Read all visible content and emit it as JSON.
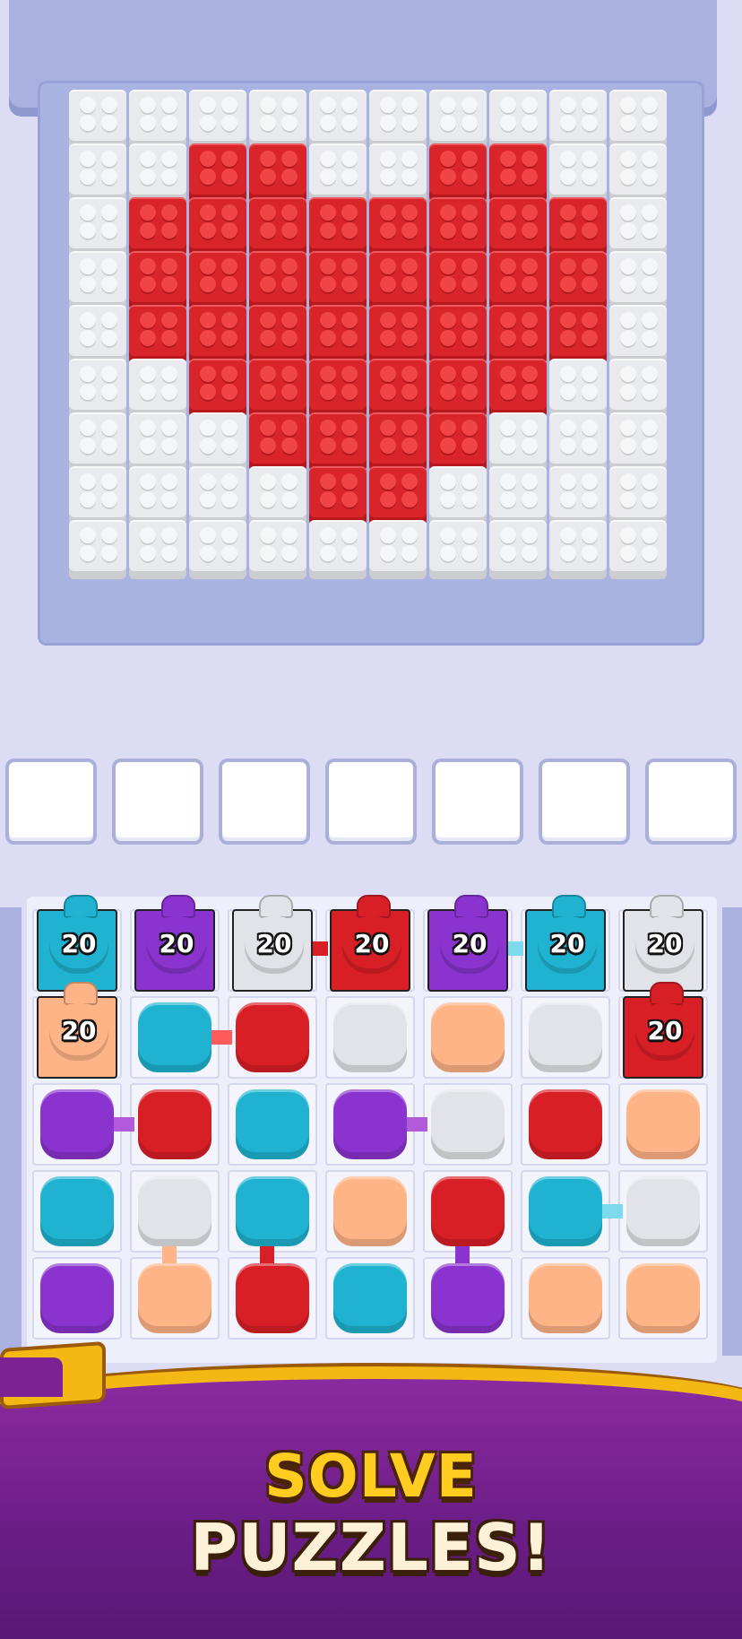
{
  "palette": {
    "cyan": "#1fb3d1",
    "purple": "#8a33cf",
    "white": "#e2e3e8",
    "red": "#d91f26",
    "peach": "#ffb488",
    "brick_white": "#e9eaee",
    "brick_red": "#d9252a"
  },
  "brick_board": {
    "rows": [
      [
        "w",
        "w",
        "w",
        "w",
        "w",
        "w",
        "w",
        "w",
        "w",
        "w"
      ],
      [
        "w",
        "w",
        "r",
        "r",
        "w",
        "w",
        "r",
        "r",
        "w",
        "w"
      ],
      [
        "w",
        "r",
        "r",
        "r",
        "r",
        "r",
        "r",
        "r",
        "r",
        "w"
      ],
      [
        "w",
        "r",
        "r",
        "r",
        "r",
        "r",
        "r",
        "r",
        "r",
        "w"
      ],
      [
        "w",
        "r",
        "r",
        "r",
        "r",
        "r",
        "r",
        "r",
        "r",
        "w"
      ],
      [
        "w",
        "w",
        "r",
        "r",
        "r",
        "r",
        "r",
        "r",
        "w",
        "w"
      ],
      [
        "w",
        "w",
        "w",
        "r",
        "r",
        "r",
        "r",
        "w",
        "w",
        "w"
      ],
      [
        "w",
        "w",
        "w",
        "w",
        "r",
        "r",
        "w",
        "w",
        "w",
        "w"
      ],
      [
        "w",
        "w",
        "w",
        "w",
        "w",
        "w",
        "w",
        "w",
        "w",
        "w"
      ]
    ]
  },
  "slots": {
    "count": 7
  },
  "counters": [
    {
      "color": "cyan",
      "count": "20"
    },
    {
      "color": "purple",
      "count": "20"
    },
    {
      "color": "white",
      "count": "20"
    },
    {
      "color": "red",
      "count": "20"
    },
    {
      "color": "purple",
      "count": "20"
    },
    {
      "color": "cyan",
      "count": "20"
    },
    {
      "color": "white",
      "count": "20"
    },
    {
      "color": "peach",
      "count": "20"
    },
    {
      "color": "red",
      "count": "20"
    }
  ],
  "tiles": [
    [
      "counter-peach",
      "cyan",
      "red",
      "white",
      "peach",
      "white",
      "counter-red"
    ],
    [
      "purple",
      "red",
      "cyan",
      "purple",
      "white",
      "red",
      "peach"
    ],
    [
      "cyan",
      "white",
      "cyan",
      "peach",
      "red",
      "cyan",
      "white"
    ],
    [
      "purple",
      "peach",
      "red",
      "cyan",
      "purple",
      "peach",
      "peach"
    ]
  ],
  "banner": {
    "line1": "SOLVE",
    "line2": "PUZZLES!"
  }
}
